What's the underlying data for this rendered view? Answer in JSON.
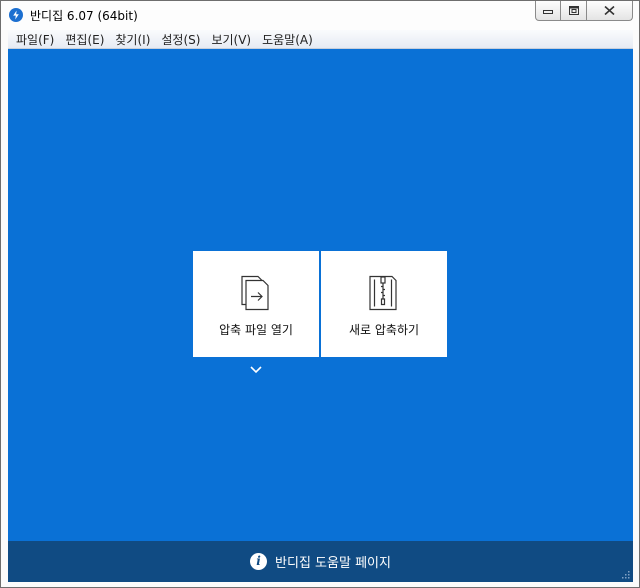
{
  "window": {
    "title": "반디집 6.07 (64bit)"
  },
  "menu": {
    "items": [
      "파일(F)",
      "편집(E)",
      "찾기(I)",
      "설정(S)",
      "보기(V)",
      "도움말(A)"
    ]
  },
  "cards": {
    "open_label": "압축 파일 열기",
    "new_label": "새로 압축하기"
  },
  "footer": {
    "help_label": "반디집 도움말 페이지",
    "info_glyph": "i"
  },
  "colors": {
    "main_background": "#0a71d6",
    "footer_background": "#104b83",
    "card_background": "#ffffff"
  },
  "icons": [
    "bandizip-app-icon",
    "minimize-icon",
    "maximize-icon",
    "close-icon",
    "open-archive-icon",
    "new-archive-icon",
    "chevron-down-icon",
    "info-icon",
    "resize-grip-icon"
  ]
}
